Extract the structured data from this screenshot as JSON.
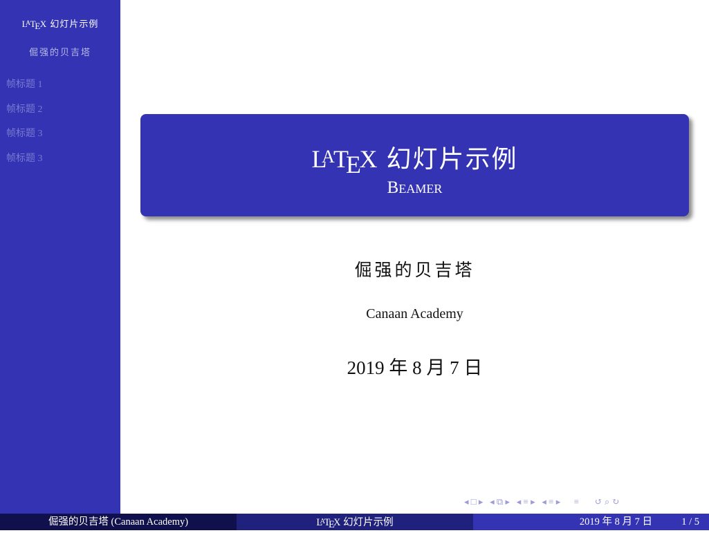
{
  "sidebar": {
    "title_tex": "LaTeX",
    "title_rest": "幻灯片示例",
    "author": "倔强的贝吉塔",
    "nav": [
      "帧标题 1",
      "帧标题 2",
      "帧标题 3",
      "帧标题 3"
    ]
  },
  "title_slide": {
    "title_rest": "幻灯片示例",
    "subtitle": "Beamer",
    "author": "倔强的贝吉塔",
    "institute": "Canaan Academy",
    "date": "2019 年 8 月 7 日"
  },
  "navigation_symbols": {
    "frame": "◂ □ ▸",
    "subsection": "◂ ⧉ ▸",
    "section": "◂ ≡ ▸",
    "section2": "◂ ≡ ▸",
    "align": "≡",
    "search": "↺ ⌕ ↻"
  },
  "footer": {
    "author_institute": "倔强的贝吉塔 (Canaan Academy)",
    "title_rest": "幻灯片示例",
    "date": "2019 年 8 月 7 日",
    "page": "1 / 5"
  },
  "colors": {
    "primary": "#3333b3",
    "footer_left": "#10104c",
    "footer_mid": "#20207d"
  }
}
